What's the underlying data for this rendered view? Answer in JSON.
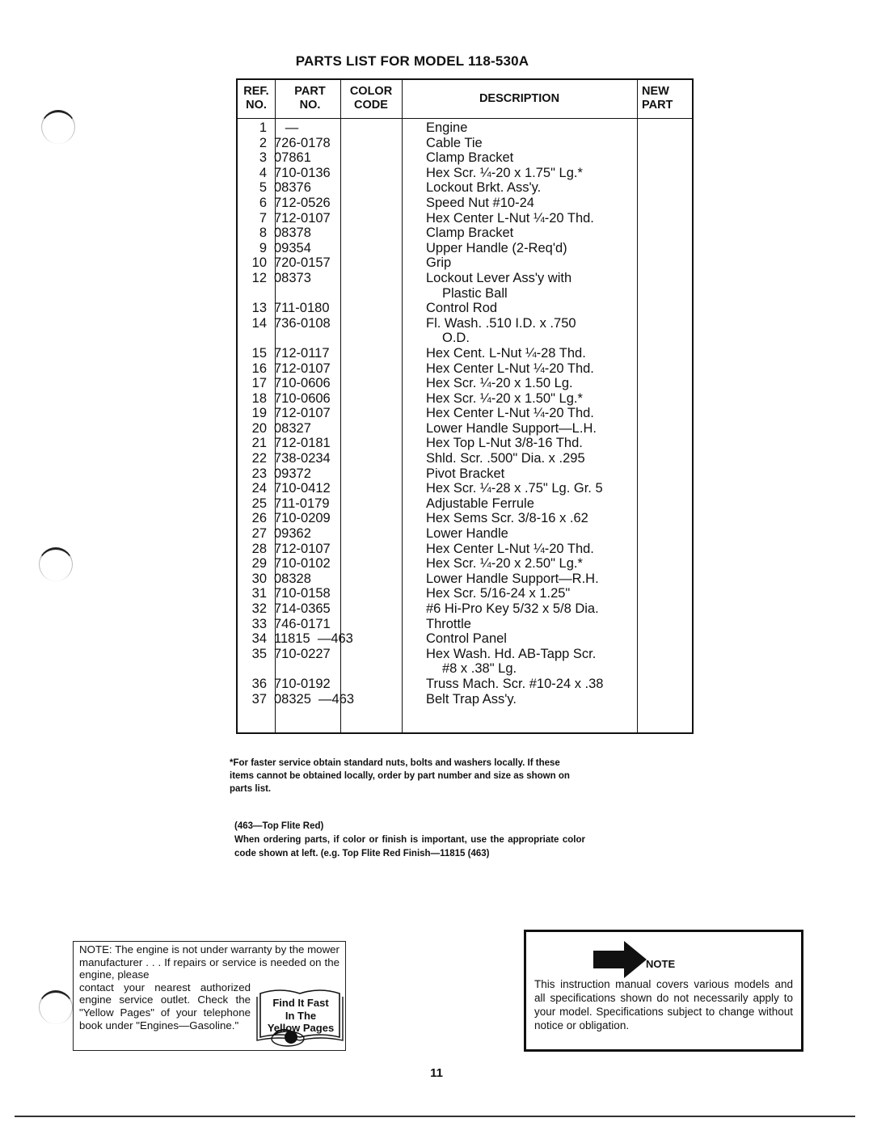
{
  "document": {
    "title": "PARTS LIST FOR MODEL 118-530A",
    "page_number": "11"
  },
  "table": {
    "headers": {
      "ref": [
        "REF.",
        "NO."
      ],
      "part": [
        "PART",
        "NO."
      ],
      "color": [
        "COLOR",
        "CODE"
      ],
      "description": "DESCRIPTION",
      "new_part": [
        "NEW",
        "PART"
      ]
    },
    "rows": [
      {
        "ref": "1",
        "part": "   —",
        "desc": "Engine"
      },
      {
        "ref": "2",
        "part": "726-0178",
        "desc": "Cable Tie"
      },
      {
        "ref": "3",
        "part": "07861",
        "desc": "Clamp Bracket"
      },
      {
        "ref": "4",
        "part": "710-0136",
        "desc": "Hex Scr. ¼-20 x 1.75\" Lg.*"
      },
      {
        "ref": "5",
        "part": "08376",
        "desc": "Lockout Brkt. Ass'y."
      },
      {
        "ref": "6",
        "part": "712-0526",
        "desc": "Speed Nut #10-24"
      },
      {
        "ref": "7",
        "part": "712-0107",
        "desc": "Hex Center L-Nut ¼-20 Thd."
      },
      {
        "ref": "8",
        "part": "08378",
        "desc": "Clamp Bracket"
      },
      {
        "ref": "9",
        "part": "09354",
        "desc": "Upper Handle (2-Req'd)"
      },
      {
        "ref": "10",
        "part": "720-0157",
        "desc": "Grip"
      },
      {
        "ref": "12",
        "part": "08373",
        "desc": "Lockout Lever Ass'y with"
      },
      {
        "ref": "",
        "part": "",
        "desc": "Plastic Ball",
        "cont": true
      },
      {
        "ref": "13",
        "part": "711-0180",
        "desc": "Control Rod"
      },
      {
        "ref": "14",
        "part": "736-0108",
        "desc": "Fl. Wash. .510 I.D. x .750"
      },
      {
        "ref": "",
        "part": "",
        "desc": "O.D.",
        "cont": true
      },
      {
        "ref": "15",
        "part": "712-0117",
        "desc": "Hex Cent. L-Nut ¼-28 Thd."
      },
      {
        "ref": "16",
        "part": "712-0107",
        "desc": "Hex Center L-Nut ¼-20 Thd."
      },
      {
        "ref": "17",
        "part": "710-0606",
        "desc": "Hex Scr. ¼-20 x 1.50 Lg."
      },
      {
        "ref": "18",
        "part": "710-0606",
        "desc": "Hex Scr. ¼-20 x 1.50\" Lg.*"
      },
      {
        "ref": "19",
        "part": "712-0107",
        "desc": "Hex Center L-Nut ¼-20 Thd."
      },
      {
        "ref": "20",
        "part": "08327",
        "desc": "Lower Handle Support—L.H."
      },
      {
        "ref": "21",
        "part": "712-0181",
        "desc": "Hex Top L-Nut 3/8-16 Thd."
      },
      {
        "ref": "22",
        "part": "738-0234",
        "desc": "Shld. Scr. .500\" Dia. x .295"
      },
      {
        "ref": "23",
        "part": "09372",
        "desc": "Pivot Bracket"
      },
      {
        "ref": "24",
        "part": "710-0412",
        "desc": "Hex Scr. ¼-28 x .75\" Lg. Gr. 5"
      },
      {
        "ref": "25",
        "part": "711-0179",
        "desc": "Adjustable Ferrule"
      },
      {
        "ref": "26",
        "part": "710-0209",
        "desc": "Hex Sems Scr. 3/8-16 x .62"
      },
      {
        "ref": "27",
        "part": "09362",
        "desc": "Lower Handle"
      },
      {
        "ref": "28",
        "part": "712-0107",
        "desc": "Hex Center L-Nut ¼-20 Thd."
      },
      {
        "ref": "29",
        "part": "710-0102",
        "desc": "Hex Scr. ¼-20 x 2.50\" Lg.*"
      },
      {
        "ref": "30",
        "part": "08328",
        "desc": "Lower Handle Support—R.H."
      },
      {
        "ref": "31",
        "part": "710-0158",
        "desc": "Hex Scr. 5/16-24 x 1.25\""
      },
      {
        "ref": "32",
        "part": "714-0365",
        "desc": "#6 Hi-Pro Key 5/32 x 5/8 Dia."
      },
      {
        "ref": "33",
        "part": "746-0171",
        "desc": "Throttle"
      },
      {
        "ref": "34",
        "part": "11815  —463",
        "desc": "Control Panel"
      },
      {
        "ref": "35",
        "part": "710-0227",
        "desc": "Hex Wash. Hd. AB-Tapp Scr."
      },
      {
        "ref": "",
        "part": "",
        "desc": "#8 x .38\" Lg.",
        "cont": true
      },
      {
        "ref": "36",
        "part": "710-0192",
        "desc": "Truss Mach. Scr. #10-24 x .38"
      },
      {
        "ref": "37",
        "part": "08325  —463",
        "desc": "Belt Trap Ass'y."
      }
    ]
  },
  "footnote": "*For faster service obtain standard nuts, bolts and washers locally. If these items cannot be obtained locally, order by part number and size as shown on parts list.",
  "color_note": {
    "heading": "(463—Top Flite Red)",
    "body": "When ordering parts, if color or finish is important, use the appropriate color code shown at left. (e.g. Top Flite Red Finish—11815 (463)"
  },
  "engine_note": {
    "lines_full": "NOTE: The engine is not under warranty by the mower manufacturer . . . If repairs or service is needed on the engine, please",
    "lines_short": "contact your nearest authorized engine service outlet. Check the \"Yellow Pages\" of your telephone book under \"Engines—Gasoline.\"",
    "book_text": [
      "Find It Fast",
      "In The",
      "Yellow Pages"
    ]
  },
  "spec_note": {
    "label": "NOTE",
    "body": "This instruction manual covers various models and all specifications shown do not necessarily apply to your model. Specifications subject to change without notice or obligation."
  }
}
